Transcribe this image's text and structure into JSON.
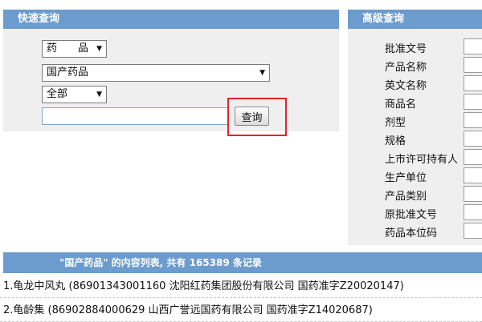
{
  "quick_search": {
    "title": "快速查询",
    "type_select": "药　　品",
    "scope_select": "国产药品",
    "subset_select": "全部",
    "query_value": "",
    "query_button": "查询"
  },
  "advanced_search": {
    "title": "高级查询",
    "fields": [
      "批准文号",
      "产品名称",
      "英文名称",
      "商品名",
      "剂型",
      "规格",
      "上市许可持有人",
      "生产单位",
      "产品类别",
      "原批准文号",
      "药品本位码"
    ]
  },
  "results": {
    "summary": "\"国产药品\" 的内容列表, 共有 165389 条记录",
    "rows": [
      "1.龟龙中风丸 (86901343001160 沈阳红药集团股份有限公司 国药准字Z20020147)",
      "2.龟龄集 (86902884000629 山西广誉远国药有限公司 国药准字Z14020687)"
    ]
  },
  "colors": {
    "header_blue": "#6c9bcd",
    "panel_gray": "#efefef",
    "highlight_red": "#e2232a"
  }
}
